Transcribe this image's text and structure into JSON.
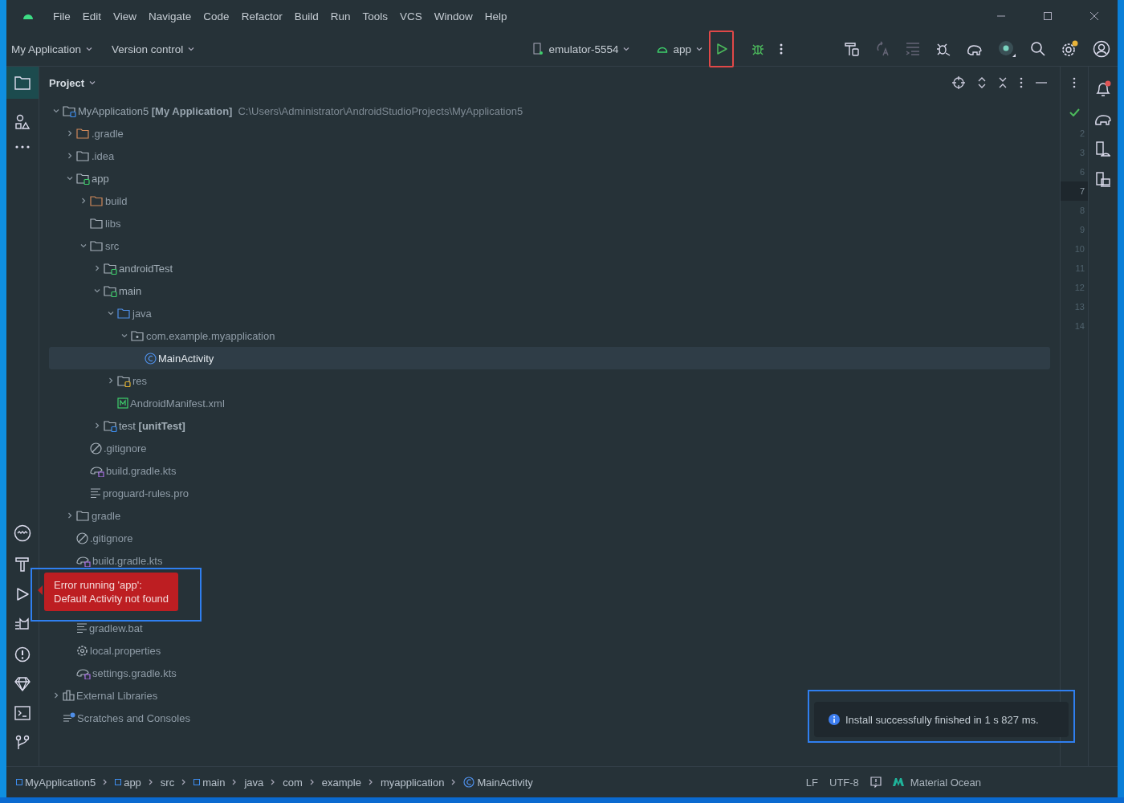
{
  "menu": [
    "File",
    "Edit",
    "View",
    "Navigate",
    "Code",
    "Refactor",
    "Build",
    "Run",
    "Tools",
    "VCS",
    "Window",
    "Help"
  ],
  "toolbar": {
    "project": "My Application",
    "vcs": "Version control",
    "device": "emulator-5554",
    "run_config": "app"
  },
  "panel": {
    "title": "Project"
  },
  "tree": [
    {
      "label": "MyApplication5 **[My Application]**",
      "path": "C:\\Users\\Administrator\\AndroidStudioProjects\\MyApplication5",
      "kind": "module",
      "expanded": true,
      "selected": false,
      "children": [
        {
          "label": ".gradle",
          "kind": "excluded",
          "expanded": false,
          "selected": false
        },
        {
          "label": ".idea",
          "kind": "folder",
          "expanded": false,
          "selected": false
        },
        {
          "label": "app",
          "kind": "source",
          "expanded": true,
          "selected": false,
          "children": [
            {
              "label": "build",
              "kind": "excluded",
              "expanded": false,
              "selected": false
            },
            {
              "label": "libs",
              "kind": "folder",
              "selected": false
            },
            {
              "label": "src",
              "kind": "folder",
              "expanded": true,
              "selected": false,
              "children": [
                {
                  "label": "androidTest",
                  "kind": "source",
                  "expanded": false,
                  "selected": false
                },
                {
                  "label": "main",
                  "kind": "source",
                  "expanded": true,
                  "selected": false,
                  "children": [
                    {
                      "label": "java",
                      "kind": "java",
                      "expanded": true,
                      "selected": false,
                      "children": [
                        {
                          "label": "com.example.myapplication",
                          "kind": "package",
                          "expanded": true,
                          "selected": false,
                          "children": [
                            {
                              "label": "MainActivity",
                              "kind": "class",
                              "selected": true
                            }
                          ]
                        }
                      ]
                    },
                    {
                      "label": "res",
                      "kind": "res",
                      "expanded": false,
                      "selected": false
                    },
                    {
                      "label": "AndroidManifest.xml",
                      "kind": "manifest",
                      "selected": false
                    }
                  ]
                },
                {
                  "label": "test **[unitTest]**",
                  "kind": "test",
                  "expanded": false,
                  "selected": false
                }
              ]
            },
            {
              "label": ".gitignore",
              "kind": "ignore",
              "selected": false
            },
            {
              "label": "build.gradle.kts",
              "kind": "gradle",
              "selected": false
            },
            {
              "label": "proguard-rules.pro",
              "kind": "text",
              "selected": false
            }
          ]
        },
        {
          "label": "gradle",
          "kind": "folder",
          "expanded": false,
          "selected": false
        },
        {
          "label": ".gitignore",
          "kind": "ignore",
          "selected": false
        },
        {
          "label": "build.gradle.kts",
          "kind": "gradle",
          "selected": false
        },
        {
          "label": "gradlew.bat",
          "kind": "text",
          "selected": false
        },
        {
          "label": "local.properties",
          "kind": "settings",
          "selected": false
        },
        {
          "label": "settings.gradle.kts",
          "kind": "gradle",
          "selected": false
        }
      ]
    },
    {
      "label": "External Libraries",
      "kind": "libraries",
      "expanded": false,
      "selected": false
    },
    {
      "label": "Scratches and Consoles",
      "kind": "scratches",
      "selected": false
    }
  ],
  "error_popup": {
    "lines": [
      "Error running 'app':",
      "Default Activity not found"
    ]
  },
  "gutter": [
    {
      "number": "2",
      "selected": false
    },
    {
      "number": "3",
      "selected": false
    },
    {
      "number": "6",
      "selected": false
    },
    {
      "number": "7",
      "selected": true
    },
    {
      "number": "8",
      "selected": false
    },
    {
      "number": "9",
      "selected": false
    },
    {
      "number": "10",
      "selected": false
    },
    {
      "number": "11",
      "selected": false
    },
    {
      "number": "12",
      "selected": false
    },
    {
      "number": "13",
      "selected": false
    },
    {
      "number": "14",
      "selected": false
    }
  ],
  "notification": {
    "text": "Install successfully finished in 1 s 827 ms."
  },
  "breadcrumbs": [
    {
      "label": "MyApplication5",
      "kind": "module"
    },
    {
      "label": "app",
      "kind": "module"
    },
    {
      "label": "src",
      "kind": "folder"
    },
    {
      "label": "main",
      "kind": "module"
    },
    {
      "label": "java",
      "kind": "folder"
    },
    {
      "label": "com",
      "kind": "folder"
    },
    {
      "label": "example",
      "kind": "folder"
    },
    {
      "label": "myapplication",
      "kind": "folder"
    },
    {
      "label": "MainActivity",
      "kind": "class"
    }
  ],
  "status": {
    "line_separator": "LF",
    "encoding": "UTF-8",
    "theme": "Material Ocean"
  }
}
